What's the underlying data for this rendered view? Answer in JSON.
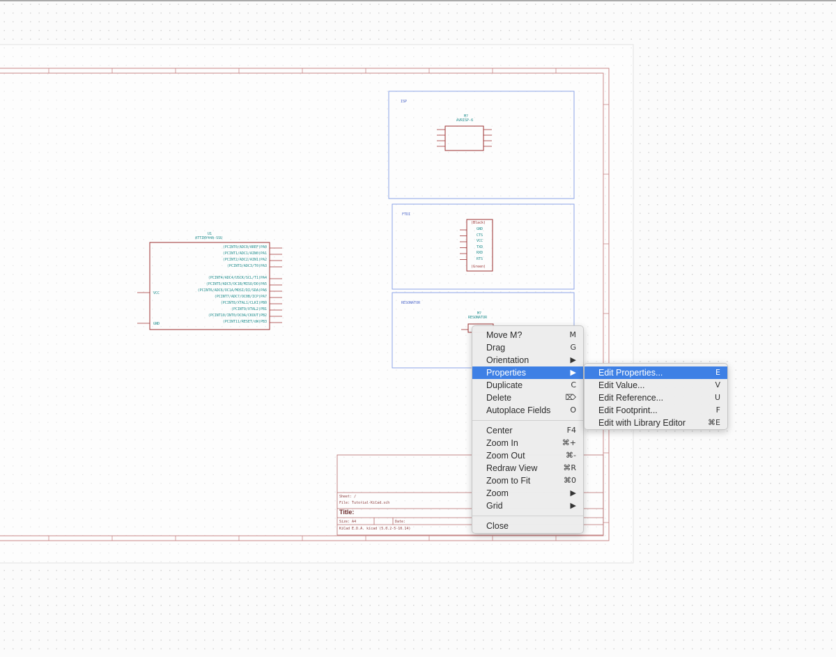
{
  "schematic": {
    "u1_ref": "U1",
    "u1_value": "ATTINY44A-SSU",
    "u1_left_pins": [
      "VCC",
      "GND"
    ],
    "u1_right_pins": [
      "(PCINT0/ADC0/AREF)PA0",
      "(PCINT1/ADC1/AIN0)PA1",
      "(PCINT2/ADC2/AIN1)PA2",
      "(PCINT3/ADC3/T0)PA3",
      "(PCINT4/ADC4/USCK/SCL/T1)PA4",
      "(PCINT5/ADC5/OC1B/MISO/DO)PA5",
      "(PCINT6/ADC6/OC1A/MOSI/DI/SDA)PA6",
      "(PCINT7/ADC7/OC0B/ICP)PA7",
      "(PCINT8/XTAL1/CLKI)PB0",
      "(PCINT9/XTAL2)PB1",
      "(PCINT10/INT0/OC0A/CKOUT)PB2",
      "(PCINT11/RESET/dW)PB3"
    ],
    "sheets": [
      {
        "name": "ISP",
        "part_ref": "M?",
        "part_value": "AVRISP-6"
      },
      {
        "name": "FTDI",
        "part_ref": "",
        "part_value": "FTDI"
      },
      {
        "name": "RESONATOR",
        "part_ref": "M?",
        "part_value": "RESONATOR"
      }
    ],
    "ftdi_pins": [
      "GND",
      "CTS",
      "VCC",
      "TXD",
      "RXD",
      "RTS"
    ],
    "ftdi_top_label": "(Black)",
    "ftdi_bottom_label": "(Green)",
    "title_block": {
      "sheet": "Sheet: /",
      "file": "File: Tutorial-KiCad.sch",
      "title": "Title:",
      "size": "Size: A4",
      "date": "Date:",
      "kicad": "KiCad E.D.A.  kicad (5.0.2-5-10.14)"
    }
  },
  "context_menu": {
    "items": [
      {
        "label": "Move M?",
        "shortcut": "M"
      },
      {
        "label": "Drag",
        "shortcut": "G"
      },
      {
        "label": "Orientation",
        "shortcut": "▶"
      },
      {
        "label": "Properties",
        "shortcut": "▶"
      },
      {
        "label": "Duplicate",
        "shortcut": "C"
      },
      {
        "label": "Delete",
        "shortcut": "⌦"
      },
      {
        "label": "Autoplace Fields",
        "shortcut": "O"
      }
    ],
    "view_items": [
      {
        "label": "Center",
        "shortcut": "F4"
      },
      {
        "label": "Zoom In",
        "shortcut": "⌘+"
      },
      {
        "label": "Zoom Out",
        "shortcut": "⌘-"
      },
      {
        "label": "Redraw View",
        "shortcut": "⌘R"
      },
      {
        "label": "Zoom to Fit",
        "shortcut": "⌘0"
      },
      {
        "label": "Zoom",
        "shortcut": "▶"
      },
      {
        "label": "Grid",
        "shortcut": "▶"
      }
    ],
    "close_label": "Close"
  },
  "submenu": {
    "items": [
      {
        "label": "Edit Properties...",
        "shortcut": "E"
      },
      {
        "label": "Edit Value...",
        "shortcut": "V"
      },
      {
        "label": "Edit Reference...",
        "shortcut": "U"
      },
      {
        "label": "Edit Footprint...",
        "shortcut": "F"
      },
      {
        "label": "Edit with Library Editor",
        "shortcut": "⌘E"
      }
    ]
  },
  "colors": {
    "border": "#b04848",
    "sheet_outline": "#8aa3e6",
    "component_body": "#8a2020",
    "pin_text": "#1a8a8a",
    "menu_highlight": "#3e80e5"
  }
}
